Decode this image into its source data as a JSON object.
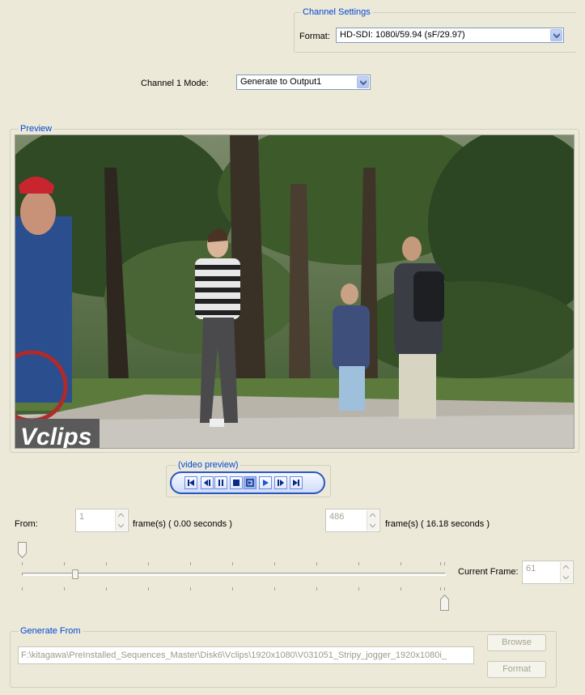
{
  "channel_settings": {
    "group_title": "Channel Settings",
    "format_label": "Format:",
    "format_value": "HD-SDI: 1080i/59.94 (sF/29.97)"
  },
  "channel_mode": {
    "label": "Channel 1 Mode:",
    "value": "Generate to Output1"
  },
  "preview": {
    "group_title": "Preview",
    "watermark": "Vclips"
  },
  "transport": {
    "title": "(video preview)",
    "buttons": [
      "go-to-start",
      "step-back",
      "pause",
      "stop",
      "loop",
      "play",
      "step-forward",
      "go-to-end"
    ]
  },
  "range": {
    "from_label": "From:",
    "from_value": "1",
    "from_units": "frame(s)  ( 0.00 seconds )",
    "to_value": "486",
    "to_units": "frame(s)  ( 16.18 seconds )",
    "current_frame_label": "Current Frame:",
    "current_frame_value": "61"
  },
  "generate_from": {
    "group_title": "Generate From",
    "path": "F:\\kitagawa\\PreInstalled_Sequences_Master\\Disk6\\Vclips\\1920x1080\\V031051_Stripy_jogger_1920x1080i_",
    "browse_label": "Browse",
    "format_label": "Format"
  },
  "colors": {
    "group_title": "#0046d5",
    "background": "#ece9d8",
    "disabled_text": "#a5a294"
  }
}
